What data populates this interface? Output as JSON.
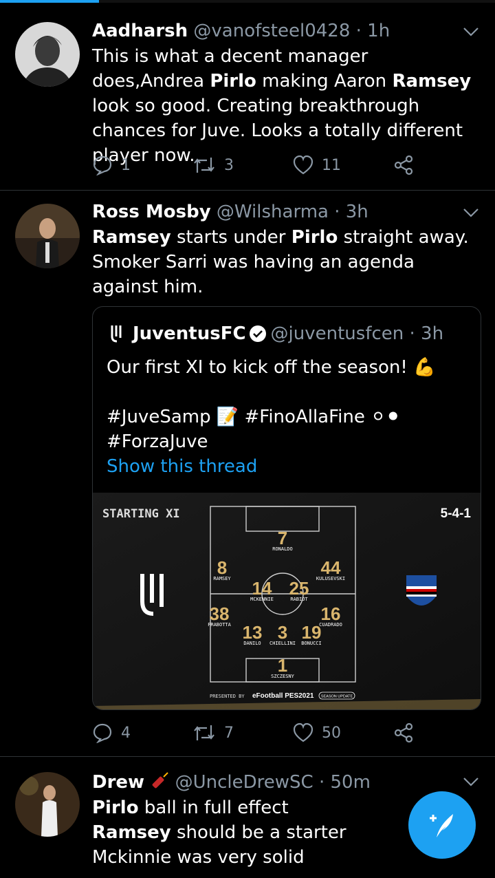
{
  "scroll_progress": 0.2,
  "colors": {
    "accent": "#1DA1F2",
    "muted": "#8b98a5",
    "background": "#000000",
    "gold": "#c9a55a"
  },
  "tweets": [
    {
      "name": "Aadharsh",
      "handle": "@vanofsteel0428",
      "time": "· 1h",
      "text": [
        "This is what a decent manager does,Andrea ",
        "Pirlo",
        " making Aaron ",
        "Ramsey",
        " look so good. Creating breakthrough chances for Juve. Looks a totally different player now."
      ],
      "replies": "1",
      "retweets": "3",
      "likes": "11"
    },
    {
      "name": "Ross Mosby",
      "handle": "@Wilsharma",
      "time": "· 3h",
      "text": [
        "Ramsey",
        " starts under ",
        "Pirlo",
        " straight away. Smoker Sarri was having an agenda against him."
      ],
      "replies": "4",
      "retweets": "7",
      "likes": "50",
      "quote": {
        "name": "JuventusFC",
        "handle": "@juventusfcen",
        "time": "· 3h",
        "line1": "Our first XI to kick off the season! 💪",
        "line2": "#JuveSamp 📝 #FinoAllaFine ⚪⚫",
        "line3": "#ForzaJuve",
        "show_thread": "Show this thread",
        "media": {
          "heading": "STARTING XI",
          "formation": "5-4-1",
          "footer_presented": "PRESENTED BY",
          "footer_brand": "eFootball PES2021",
          "footer_badge": "SEASON UPDATE",
          "players": [
            {
              "num": "7",
              "name": "RONALDO"
            },
            {
              "num": "8",
              "name": "RAMSEY"
            },
            {
              "num": "44",
              "name": "KULUSEVSKI"
            },
            {
              "num": "14",
              "name": "MCKENNIE"
            },
            {
              "num": "25",
              "name": "RABIOT"
            },
            {
              "num": "38",
              "name": "FRABOTTA"
            },
            {
              "num": "16",
              "name": "CUADRADO"
            },
            {
              "num": "13",
              "name": "DANILO"
            },
            {
              "num": "3",
              "name": "CHIELLINI"
            },
            {
              "num": "19",
              "name": "BONUCCI"
            },
            {
              "num": "1",
              "name": "SZCZESNY"
            }
          ]
        }
      }
    },
    {
      "name": "Drew",
      "handle": "@UncleDrewSC",
      "time": "· 50m",
      "line1a": "Pirlo",
      "line1b": " ball in full effect",
      "line2a": "Ramsey",
      "line2b": " should be a starter",
      "line3": "Mckinnie was very solid"
    }
  ]
}
